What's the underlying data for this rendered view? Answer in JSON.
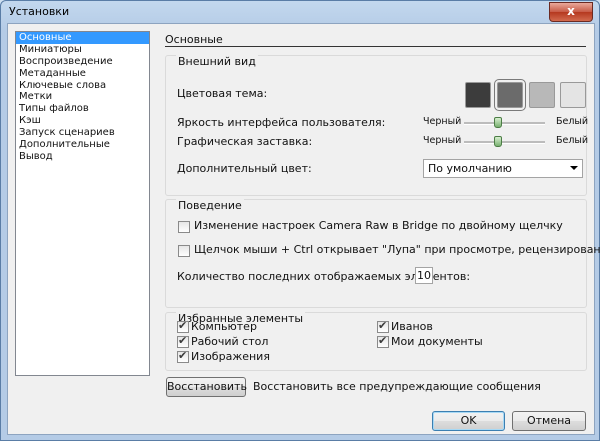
{
  "window": {
    "title": "Установки",
    "close_label": "x"
  },
  "sidebar": {
    "items": [
      "Основные",
      "Миниатюры",
      "Воспроизведение",
      "Метаданные",
      "Ключевые слова",
      "Метки",
      "Типы файлов",
      "Кэш",
      "Запуск сценариев",
      "Дополнительные",
      "Вывод"
    ],
    "selected": "Основные"
  },
  "page_title": "Основные",
  "appearance": {
    "title": "Внешний вид",
    "color_theme_label": "Цветовая тема:",
    "theme_swatches": [
      "#3c3c3c",
      "#6b6b6b",
      "#b8b8b8",
      "#e4e4e4"
    ],
    "brightness_label": "Яркость интерфейса пользователя:",
    "splash_label": "Графическая заставка:",
    "slider_min": "Черный",
    "slider_max": "Белый",
    "brightness_value": 0.42,
    "splash_value": 0.42,
    "accent_label": "Дополнительный цвет:",
    "accent_value": "По умолчанию"
  },
  "behavior": {
    "title": "Поведение",
    "camera_raw_label": "Изменение настроек Camera Raw в Bridge по двойному щелчку",
    "loupe_label": "Щелчок мыши + Ctrl открывает \"Лупа\" при просмотре, рецензировании.",
    "recent_label": "Количество последних отображаемых элементов:",
    "recent_value": "10"
  },
  "favorites": {
    "title": "Избранные элементы",
    "items": [
      "Компьютер",
      "Рабочий стол",
      "Изображения",
      "Иванов",
      "Мои документы"
    ]
  },
  "footer": {
    "restore_button": "Восстановить",
    "restore_text": "Восстановить все предупреждающие сообщения",
    "ok_button": "OK",
    "cancel_button": "Отмена"
  }
}
